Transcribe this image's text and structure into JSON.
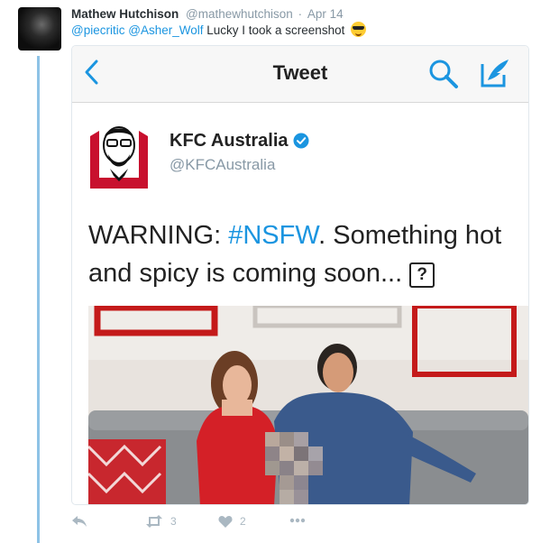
{
  "tweet": {
    "author_name": "Mathew Hutchison",
    "author_handle": "@mathewhutchison",
    "separator": "·",
    "date": "Apr 14",
    "mentions": [
      "@piecritic",
      "@Asher_Wolf"
    ],
    "text": "Lucky I took a screenshot",
    "emoji": "smiling-face-with-sunglasses"
  },
  "screenshot": {
    "nav_title": "Tweet",
    "quoted_author_name": "KFC Australia",
    "quoted_author_handle": "@KFCAustralia",
    "quoted_text_prefix": "WARNING: ",
    "quoted_hashtag": "#NSFW",
    "quoted_text_rest": ". Something hot and spicy is coming soon...",
    "quoted_emoji": "?"
  },
  "actions": {
    "retweet_count": "3",
    "like_count": "2"
  },
  "colors": {
    "link": "#1b95e0",
    "thread_line": "#8ec3e6",
    "kfc_red": "#c8102e",
    "action_gray": "#aab8c2"
  }
}
